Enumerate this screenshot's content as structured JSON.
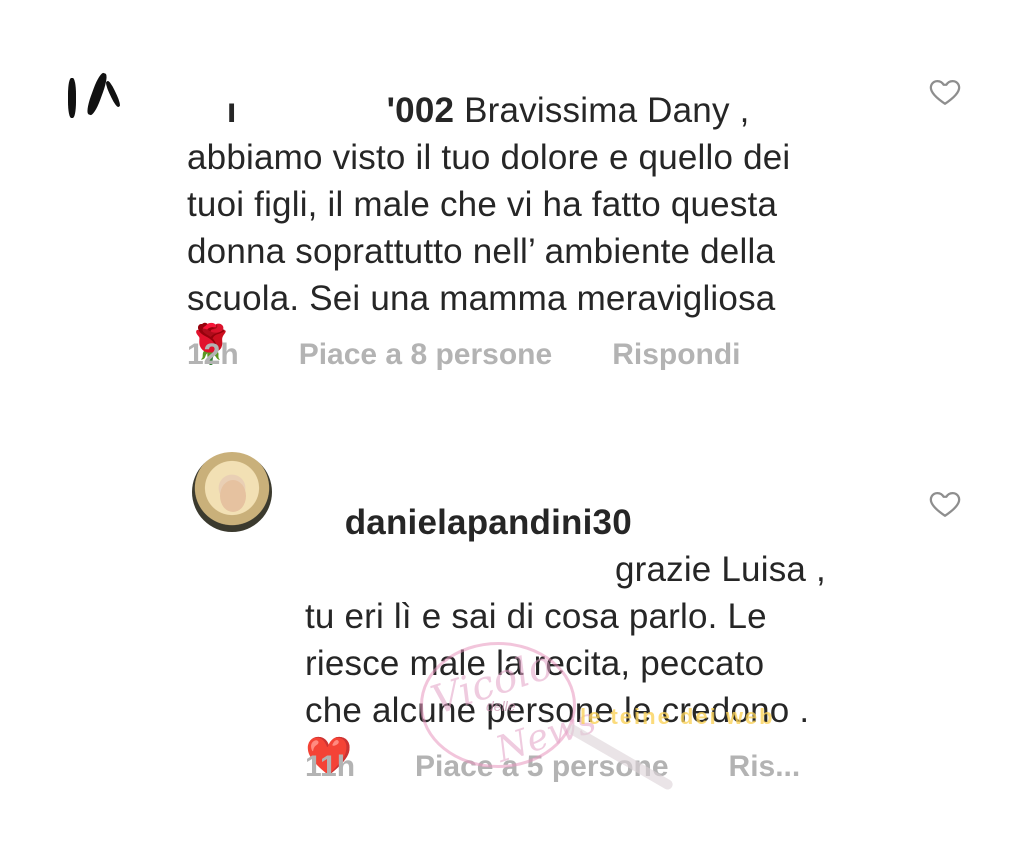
{
  "comments": [
    {
      "username_visible": "ı",
      "username_tail": "'002",
      "text_line1": " Bravissima Dany ,",
      "text_rest": "abbiamo visto il tuo dolore e quello dei\ntuoi figli, il male che vi ha fatto questa\ndonna soprattutto nell’ ambiente della\nscuola. Sei una mamma meravigliosa",
      "emoji": "🌹",
      "time": "12h",
      "likes": "Piace a 8 persone",
      "reply": "Rispondi"
    },
    {
      "username": "danielapandini30",
      "text_line1": "grazie Luisa ,",
      "text_rest": "tu eri lì e sai di cosa parlo. Le\nriesce male la recita, peccato\nche alcune persone le credono .",
      "emoji": "❤️",
      "time": "11h",
      "likes": "Piace a 5 persone",
      "reply": "Ris..."
    }
  ],
  "watermark": {
    "script_1": "Vicolo",
    "small": "delle",
    "script_2": "News",
    "banner": "le teine dei web"
  },
  "icons": {
    "like": "heart-outline-icon"
  }
}
